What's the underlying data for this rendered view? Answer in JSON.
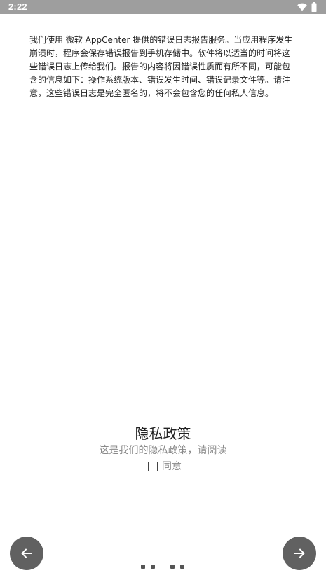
{
  "status_bar": {
    "time": "2:22",
    "icons": [
      "wifi-icon",
      "battery-icon"
    ]
  },
  "notice": {
    "text": "我们使用 微软 AppCenter 提供的错误日志报告服务。当应用程序发生崩溃时，程序会保存错误报告到手机存储中。软件将以适当的时间将这些错误日志上传给我们。报告的内容将因错误性质而有所不同，可能包含的信息如下：操作系统版本、错误发生时间、错误记录文件等。请注意，这些错误日志是完全匿名的，将不会包含您的任何私人信息。"
  },
  "privacy": {
    "title": "隐私政策",
    "subtitle": "这是我们的隐私政策，请阅读",
    "agree_label": "同意",
    "agree_checked": false
  },
  "navigation": {
    "back_icon": "arrow-left-icon",
    "next_icon": "arrow-right-icon",
    "page_count": 4
  },
  "colors": {
    "status_bar": "#9e9e9e",
    "nav_button": "#616161",
    "subtitle": "#8a8a8a"
  }
}
